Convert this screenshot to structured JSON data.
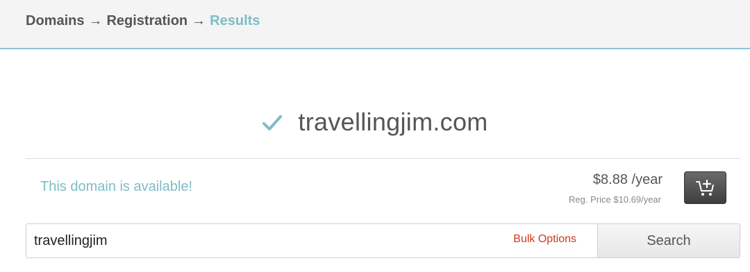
{
  "breadcrumb": {
    "items": [
      "Domains",
      "Registration",
      "Results"
    ],
    "separator": "→"
  },
  "result": {
    "domain": "travellingjim.com",
    "status_icon": "check-icon",
    "availability_text": "This domain is available!",
    "price": "$8.88 /year",
    "reg_price": "Reg. Price $10.69/year",
    "cart_icon": "add-to-cart-icon"
  },
  "search": {
    "value": "travellingjim",
    "bulk_options_label": "Bulk Options",
    "button_label": "Search"
  },
  "colors": {
    "accent": "#7fbcc6",
    "header_border": "#8fc3d3",
    "bulk_link": "#d0371a",
    "cart_button": "#4a4a4a"
  }
}
